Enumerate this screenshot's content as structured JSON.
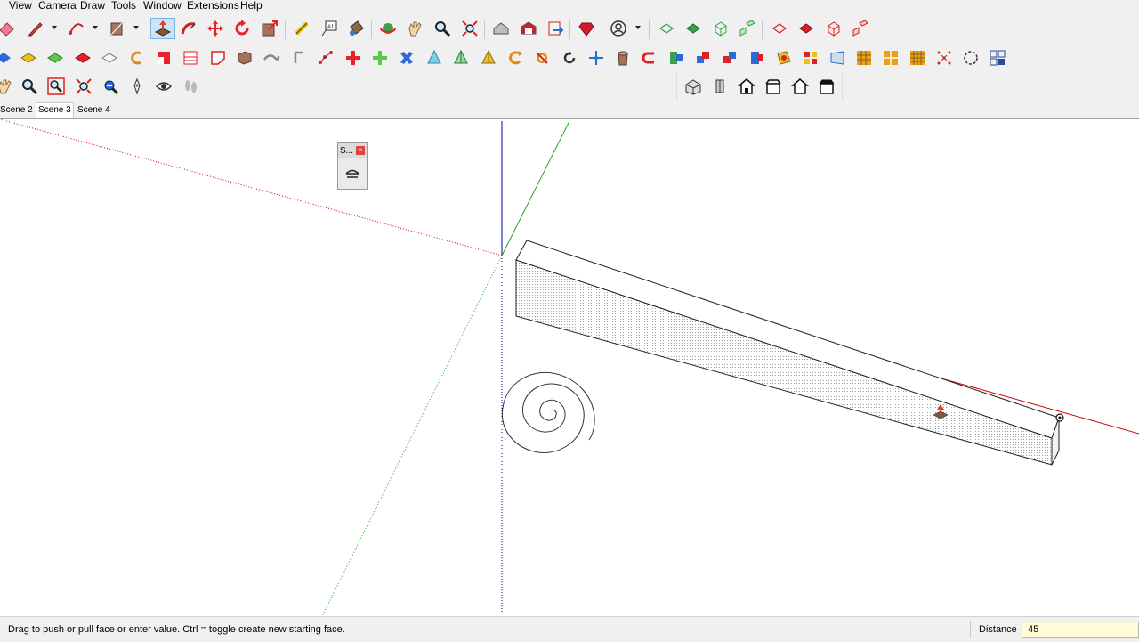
{
  "menu": {
    "items": [
      "View",
      "Camera",
      "Draw",
      "Tools",
      "Window",
      "Extensions",
      "Help"
    ]
  },
  "toolbars": {
    "row1": [
      "eraser-icon",
      "pencil-line-icon",
      "arc-icon",
      "rectangle-icon",
      "push-pull-icon",
      "follow-me-icon",
      "move-icon",
      "rotate-icon",
      "scale-icon",
      "tape-measure-icon",
      "text-icon",
      "paint-bucket-icon",
      "orbit-icon",
      "pan-icon",
      "zoom-icon",
      "zoom-extents-icon",
      "warehouse-icon",
      "extension-warehouse-icon",
      "send-to-layout-icon",
      "ruby-console-icon",
      "account-icon",
      "style-xray-icon",
      "style-wireframe-icon",
      "style-hidden-line-icon",
      "style-shaded-icon",
      "section-plane-icon",
      "section-display-icon",
      "section-cut-icon",
      "section-fill-icon"
    ],
    "row2": [
      "select-icon",
      "make-component-icon",
      "paint-icon",
      "eraser2-icon",
      "layers-icon",
      "arc2-icon",
      "rectangle2-icon",
      "circle-icon",
      "polygon-icon",
      "freehand-icon",
      "offset-icon",
      "curve-icon",
      "cross-icon",
      "add-icon",
      "explode-icon",
      "cone-icon",
      "tree-icon",
      "tent-icon",
      "loop-icon",
      "bucket-icon",
      "gear-icon",
      "crosshair-icon",
      "cylinder-icon",
      "magnet-icon",
      "sandbox-icon",
      "flip-icon",
      "mirror-icon",
      "split-icon",
      "extrude-icon",
      "texture-icon",
      "grid-icon",
      "tile-icon",
      "grid2-icon",
      "points-icon",
      "circle-dots-icon",
      "layout-icon"
    ],
    "row3": [
      "walk-hand-icon",
      "zoom3-icon",
      "zoom-window-icon",
      "zoom-extents2-icon",
      "previous-view-icon",
      "position-camera-icon",
      "look-around-icon",
      "walk-icon"
    ],
    "views": [
      "iso-view-icon",
      "top-view-icon",
      "front-view-icon",
      "right-view-icon",
      "back-view-icon",
      "left-view-icon"
    ]
  },
  "scenes": {
    "tabs": [
      "Scene 2",
      "Scene 3",
      "Scene 4"
    ],
    "active": "Scene 3"
  },
  "mini_panel": {
    "title": "S...",
    "close": "×"
  },
  "status": {
    "message": "Drag to push or pull face or enter value.  Ctrl = toggle create new starting face.",
    "vcb_label": "Distance",
    "vcb_value": "45"
  },
  "colors": {
    "axis_red": "#d10000",
    "axis_green": "#23a11e",
    "axis_blue": "#0000aa",
    "toolbar_bg": "#f0f0f0",
    "vcb_bg": "#fffbd6"
  }
}
